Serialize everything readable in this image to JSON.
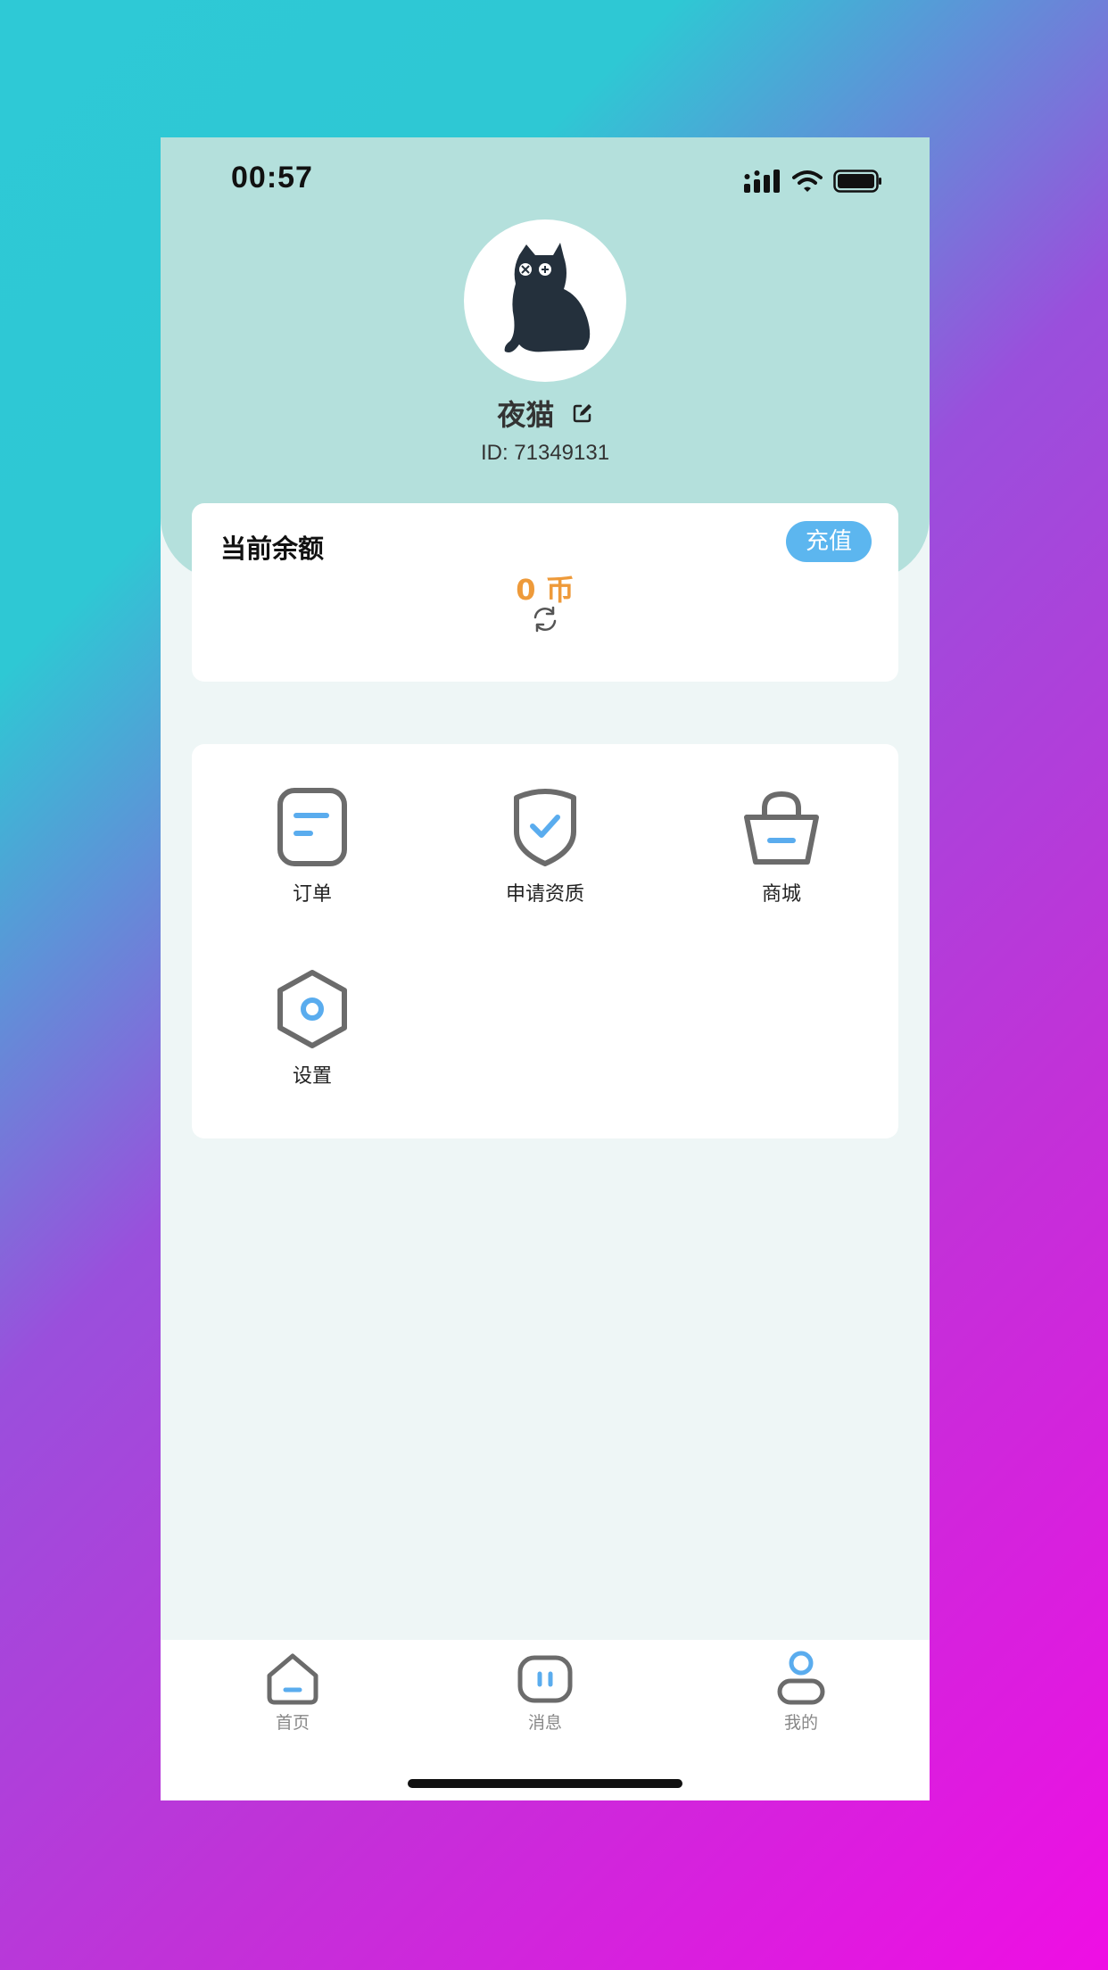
{
  "status_bar": {
    "time": "00:57",
    "icons": [
      "signal-icon",
      "wifi-icon",
      "battery-icon"
    ]
  },
  "profile": {
    "avatar": "black-cat-avatar",
    "nickname": "夜猫",
    "edit_icon": "edit-icon",
    "id_text": "ID: 71349131"
  },
  "balance": {
    "title": "当前余额",
    "recharge_label": "充值",
    "value_text": "0 币",
    "refresh_icon": "refresh-icon"
  },
  "menu": {
    "items": [
      {
        "label": "订单",
        "icon": "order-icon"
      },
      {
        "label": "申请资质",
        "icon": "shield-check-icon"
      },
      {
        "label": "商城",
        "icon": "shopping-basket-icon"
      },
      {
        "label": "设置",
        "icon": "settings-hexagon-icon"
      }
    ]
  },
  "tabbar": {
    "items": [
      {
        "label": "首页",
        "icon": "home-icon"
      },
      {
        "label": "消息",
        "icon": "message-icon"
      },
      {
        "label": "我的",
        "icon": "user-icon",
        "active": true
      }
    ]
  },
  "colors": {
    "header_bg": "#b4e0dc",
    "page_bg": "#eef6f6",
    "accent_blue": "#5cb6ef",
    "icon_gray": "#6b6b6b",
    "balance_orange": "#ee9a3a"
  }
}
